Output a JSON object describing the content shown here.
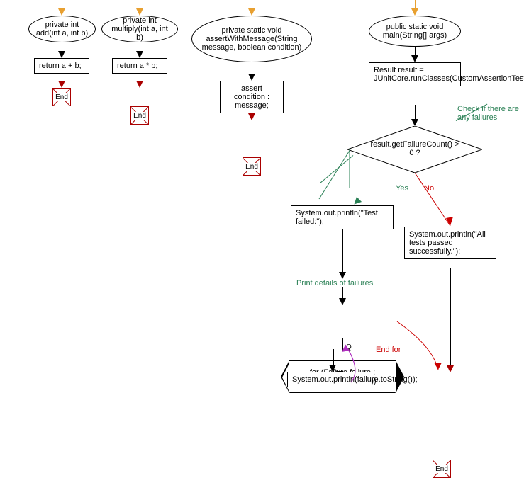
{
  "flow1": {
    "header": "private int\nadd(int a, int b)",
    "body": "return a + b;",
    "end": "End"
  },
  "flow2": {
    "header": "private int\nmultiply(int a, int b)",
    "body": "return a * b;",
    "end": "End"
  },
  "flow3": {
    "header": "private static void assertWithMessage(String message, boolean condition)",
    "body": "assert condition : message;",
    "end": "End"
  },
  "flow4": {
    "header": "public static void main(String[] args)",
    "step1": "Result result = JUnitCore.runClasses(CustomAssertionTest.class);",
    "comment1": "Check if there are any failures",
    "decision": "result.getFailureCount() > 0 ?",
    "yes": "Yes",
    "no": "No",
    "yesBranch": "System.out.println(\"Test failed:\");",
    "noBranch": "System.out.println(\"All tests passed successfully.\");",
    "comment2": "Print details of failures",
    "loop": "for (Failure failure : result.getFailures())",
    "loopBody": "System.out.println(failure.toString());",
    "q": "Q",
    "endfor": "End for",
    "end": "End"
  }
}
